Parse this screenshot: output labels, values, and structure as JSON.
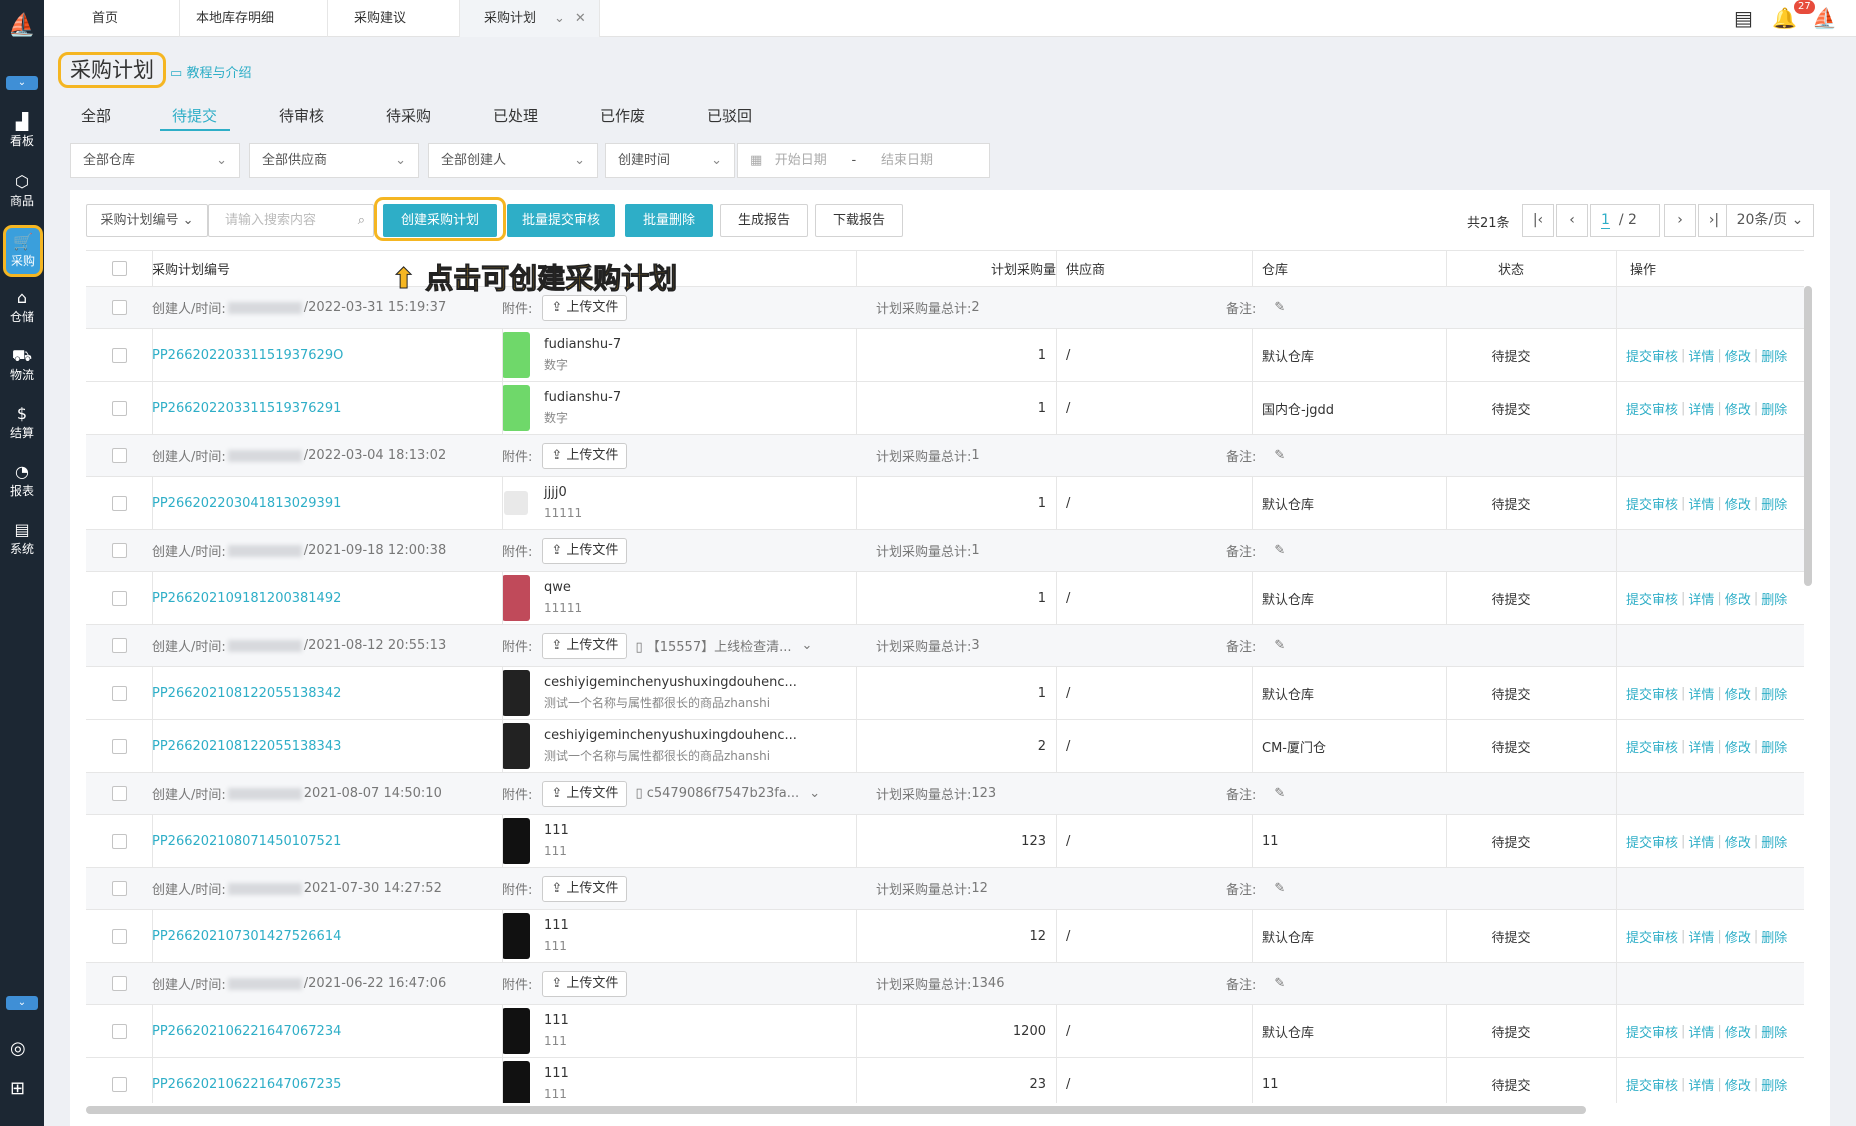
{
  "sidebar": [
    {
      "label": "看板",
      "icon": "chart-icon"
    },
    {
      "label": "商品",
      "icon": "box-icon"
    },
    {
      "label": "采购",
      "icon": "cart-icon"
    },
    {
      "label": "仓储",
      "icon": "warehouse-icon"
    },
    {
      "label": "物流",
      "icon": "truck-icon"
    },
    {
      "label": "结算",
      "icon": "money-icon"
    },
    {
      "label": "报表",
      "icon": "pie-icon"
    },
    {
      "label": "系统",
      "icon": "system-icon"
    }
  ],
  "tabs": [
    "首页",
    "本地库存明细",
    "采购建议",
    "采购计划"
  ],
  "notifications": "27",
  "page_title": "采购计划",
  "tutorial": "教程与介绍",
  "subtabs": [
    "全部",
    "待提交",
    "待审核",
    "待采购",
    "已处理",
    "已作废",
    "已驳回"
  ],
  "filters": {
    "warehouse": "全部仓库",
    "supplier": "全部供应商",
    "creator": "全部创建人",
    "time": "创建时间",
    "start": "开始日期",
    "dash": "-",
    "end": "结束日期"
  },
  "toolbar": {
    "search_type": "采购计划编号",
    "search_ph": "请输入搜索内容",
    "create": "创建采购计划",
    "batch_submit": "批量提交审核",
    "batch_delete": "批量删除",
    "gen_report": "生成报告",
    "download": "下载报告"
  },
  "pager": {
    "total": "共21条",
    "current": "1",
    "pages": "/ 2",
    "size": "20条/页"
  },
  "annotation": "点击可创建采购计划",
  "columns": {
    "id": "采购计划编号",
    "qty": "计划采购量",
    "supplier": "供应商",
    "warehouse": "仓库",
    "status": "状态",
    "ops": "操作"
  },
  "labels": {
    "creator": "创建人/时间:",
    "attach": "附件:",
    "upload": "上传文件",
    "total": "计划采购量总计:",
    "remark": "备注:"
  },
  "ops": [
    "提交审核",
    "详情",
    "修改",
    "删除"
  ],
  "groups": [
    {
      "time": "/2022-03-31 15:19:37",
      "total": "2",
      "file": "",
      "items": [
        {
          "id": "PP26620220331151937629O",
          "name": "fudianshu-7",
          "sku": "数字",
          "qty": "1",
          "supplier": "/",
          "wh": "默认仓库",
          "status": "待提交",
          "img": "green"
        },
        {
          "id": "PP266202203311519376291",
          "name": "fudianshu-7",
          "sku": "数字",
          "qty": "1",
          "supplier": "/",
          "wh": "国内仓-jgdd",
          "status": "待提交",
          "img": "green"
        }
      ]
    },
    {
      "time": "/2022-03-04 18:13:02",
      "total": "1",
      "file": "",
      "items": [
        {
          "id": "PP266202203041813029391",
          "name": "jjjj0",
          "sku": "11111",
          "qty": "1",
          "supplier": "/",
          "wh": "默认仓库",
          "status": "待提交",
          "img": "none"
        }
      ]
    },
    {
      "time": "/2021-09-18 12:00:38",
      "total": "1",
      "file": "",
      "items": [
        {
          "id": "PP266202109181200381492",
          "name": "qwe",
          "sku": "11111",
          "qty": "1",
          "supplier": "/",
          "wh": "默认仓库",
          "status": "待提交",
          "img": "red"
        }
      ]
    },
    {
      "time": "/2021-08-12 20:55:13",
      "total": "3",
      "file": "【15557】上线检查清...",
      "items": [
        {
          "id": "PP266202108122055138342",
          "name": "ceshiyigeminchenyushuxingdouhenc...",
          "sku": "测试一个名称与属性都很长的商品zhanshi",
          "qty": "1",
          "supplier": "/",
          "wh": "默认仓库",
          "status": "待提交",
          "img": "black"
        },
        {
          "id": "PP266202108122055138343",
          "name": "ceshiyigeminchenyushuxingdouhenc...",
          "sku": "测试一个名称与属性都很长的商品zhanshi",
          "qty": "2",
          "supplier": "/",
          "wh": "CM-厦门仓",
          "status": "待提交",
          "img": "black"
        }
      ]
    },
    {
      "time": "2021-08-07 14:50:10",
      "total": "123",
      "file": "c5479086f7547b23fa...",
      "items": [
        {
          "id": "PP266202108071450107521",
          "name": "111",
          "sku": "111",
          "qty": "123",
          "supplier": "/",
          "wh": "11",
          "status": "待提交",
          "img": "dress"
        }
      ]
    },
    {
      "time": "2021-07-30 14:27:52",
      "total": "12",
      "file": "",
      "items": [
        {
          "id": "PP266202107301427526614",
          "name": "111",
          "sku": "111",
          "qty": "12",
          "supplier": "/",
          "wh": "默认仓库",
          "status": "待提交",
          "img": "dress"
        }
      ]
    },
    {
      "time": "/2021-06-22 16:47:06",
      "total": "1346",
      "file": "",
      "items": [
        {
          "id": "PP266202106221647067234",
          "name": "111",
          "sku": "111",
          "qty": "1200",
          "supplier": "/",
          "wh": "默认仓库",
          "status": "待提交",
          "img": "dress"
        },
        {
          "id": "PP266202106221647067235",
          "name": "111",
          "sku": "111",
          "qty": "23",
          "supplier": "/",
          "wh": "11",
          "status": "待提交",
          "img": "dress"
        }
      ]
    }
  ]
}
